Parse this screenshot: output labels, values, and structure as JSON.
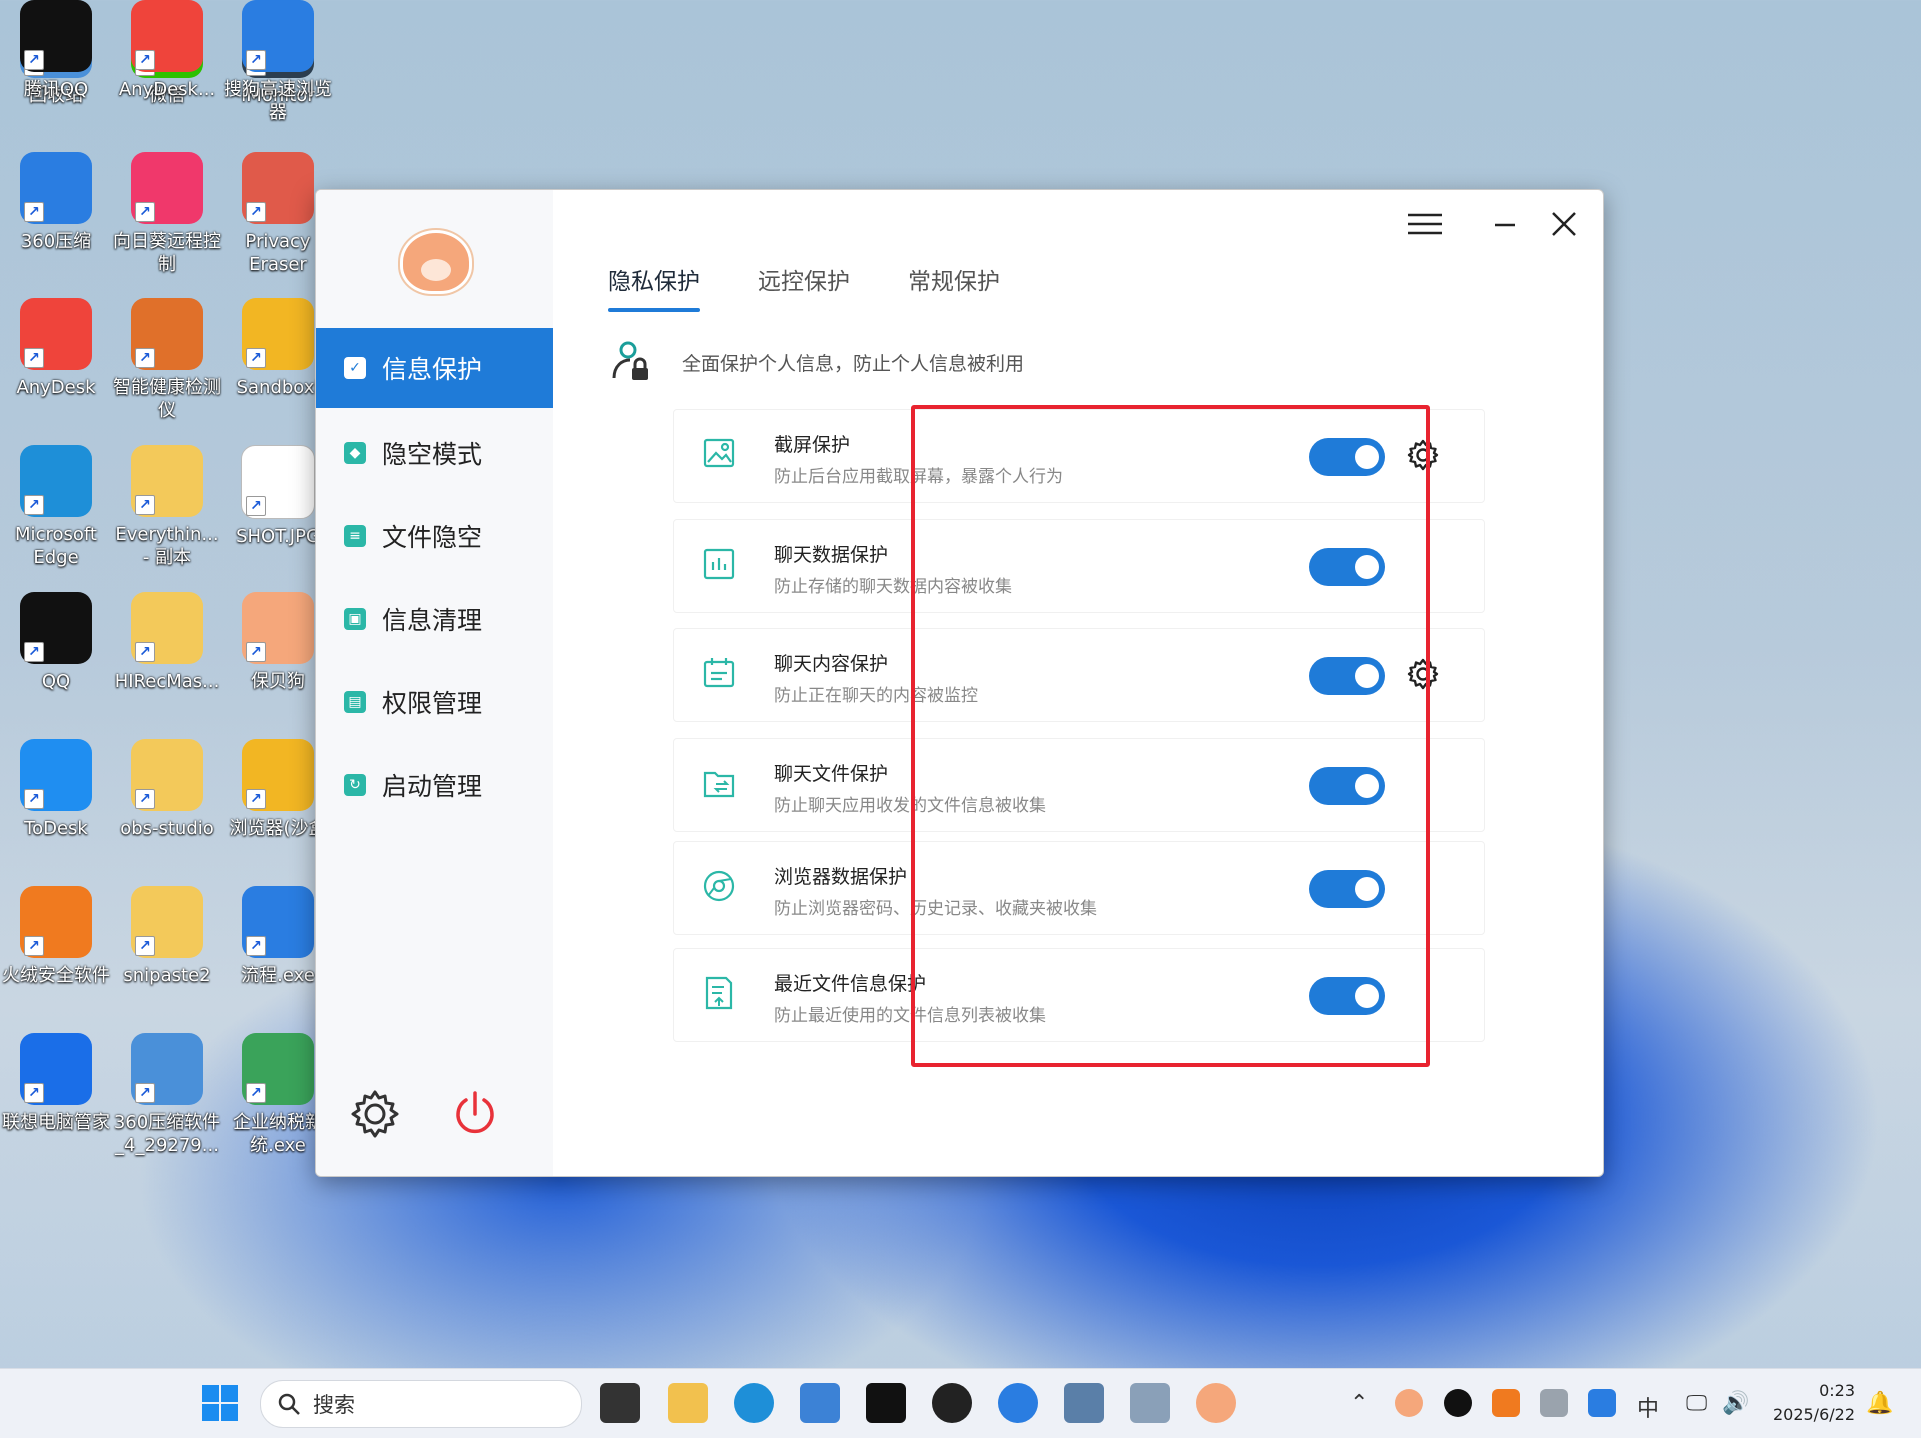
{
  "desktop": {
    "icons": [
      {
        "label": "回收站",
        "icon": "recycle-bin-icon",
        "color": "#4a90d9"
      },
      {
        "label": "微信",
        "icon": "wechat-icon",
        "color": "#2dc100"
      },
      {
        "label": "iMonitor",
        "icon": "monitor-icon",
        "color": "#2c3e50"
      },
      {
        "label": "360压缩",
        "icon": "archive-icon",
        "color": "#2a7de1"
      },
      {
        "label": "向日葵远程控制",
        "icon": "sunflower-remote-icon",
        "color": "#f0386b"
      },
      {
        "label": "Privacy Eraser",
        "icon": "eraser-icon",
        "color": "#e05a4a"
      },
      {
        "label": "AnyDesk",
        "icon": "anydesk-icon",
        "color": "#ef443b"
      },
      {
        "label": "智能健康检测仪",
        "icon": "health-icon",
        "color": "#e0702a"
      },
      {
        "label": "Sandboxi",
        "icon": "sandbox-icon",
        "color": "#f2b623"
      },
      {
        "label": "Microsoft Edge",
        "icon": "edge-icon",
        "color": "#1e8fd8"
      },
      {
        "label": "Everythin... - 副本",
        "icon": "folder-icon",
        "color": "#f3c95a"
      },
      {
        "label": "SHOT.JPG",
        "icon": "file-icon",
        "color": "#ffffff"
      },
      {
        "label": "QQ",
        "icon": "qq-icon",
        "color": "#111111"
      },
      {
        "label": "HIRecMas...",
        "icon": "folder-icon",
        "color": "#f3c95a"
      },
      {
        "label": "保贝狗",
        "icon": "baobeigou-icon",
        "color": "#f5a77b"
      },
      {
        "label": "ToDesk",
        "icon": "todesk-icon",
        "color": "#1f8ef1"
      },
      {
        "label": "obs-studio",
        "icon": "folder-icon",
        "color": "#f3c95a"
      },
      {
        "label": "浏览器(沙盒",
        "icon": "sandbox-browser-icon",
        "color": "#f2b623"
      },
      {
        "label": "火绒安全软件",
        "icon": "huorong-icon",
        "color": "#f07a1f"
      },
      {
        "label": "snipaste2",
        "icon": "folder-icon",
        "color": "#f3c95a"
      },
      {
        "label": "流程.exe",
        "icon": "flow-exe-icon",
        "color": "#2a7de1"
      },
      {
        "label": "联想电脑管家",
        "icon": "lenovo-icon",
        "color": "#1a6ee8"
      },
      {
        "label": "360压缩软件_4_29279...",
        "icon": "installer-icon",
        "color": "#4a90d9"
      },
      {
        "label": "企业纳税新统.exe",
        "icon": "tax-icon",
        "color": "#3aa35a"
      },
      {
        "label": "腾讯QQ",
        "icon": "qq-icon",
        "color": "#111111"
      },
      {
        "label": "AnyDesk...",
        "icon": "anydesk-icon",
        "color": "#ef443b"
      },
      {
        "label": "搜狗高速浏览器",
        "icon": "sogou-browser-icon",
        "color": "#2a7de1"
      }
    ]
  },
  "app": {
    "sidebar": {
      "items": [
        {
          "label": "信息保护",
          "glyph": "✓"
        },
        {
          "label": "隐空模式",
          "glyph": "◆"
        },
        {
          "label": "文件隐空",
          "glyph": "≡"
        },
        {
          "label": "信息清理",
          "glyph": "▣"
        },
        {
          "label": "权限管理",
          "glyph": "▤"
        },
        {
          "label": "启动管理",
          "glyph": "↻"
        }
      ],
      "accent": "#1f7bd8"
    },
    "tabs": [
      {
        "label": "隐私保护"
      },
      {
        "label": "远控保护"
      },
      {
        "label": "常规保护"
      }
    ],
    "intro_text": "全面保护个人信息，防止个人信息被利用",
    "cards": [
      {
        "title": "截屏保护",
        "desc": "防止后台应用截取屏幕，暴露个人行为",
        "enabled": true,
        "has_settings": true,
        "icon": "screenshot-icon"
      },
      {
        "title": "聊天数据保护",
        "desc": "防止存储的聊天数据内容被收集",
        "enabled": true,
        "has_settings": false,
        "icon": "chart-icon"
      },
      {
        "title": "聊天内容保护",
        "desc": "防止正在聊天的内容被监控",
        "enabled": true,
        "has_settings": true,
        "icon": "calendar-icon"
      },
      {
        "title": "聊天文件保护",
        "desc": "防止聊天应用收发的文件信息被收集",
        "enabled": true,
        "has_settings": false,
        "icon": "folder-transfer-icon"
      },
      {
        "title": "浏览器数据保护",
        "desc": "防止浏览器密码、历史记录、收藏夹被收集",
        "enabled": true,
        "has_settings": false,
        "icon": "browser-icon"
      },
      {
        "title": "最近文件信息保护",
        "desc": "防止最近使用的文件信息列表被收集",
        "enabled": true,
        "has_settings": false,
        "icon": "recent-file-icon"
      }
    ],
    "highlight_color": "#e8232f",
    "toggle_color": "#1f7bd8"
  },
  "taskbar": {
    "search_placeholder": "搜索",
    "ime": "中",
    "time": "0:23",
    "date": "2025/6/22"
  }
}
